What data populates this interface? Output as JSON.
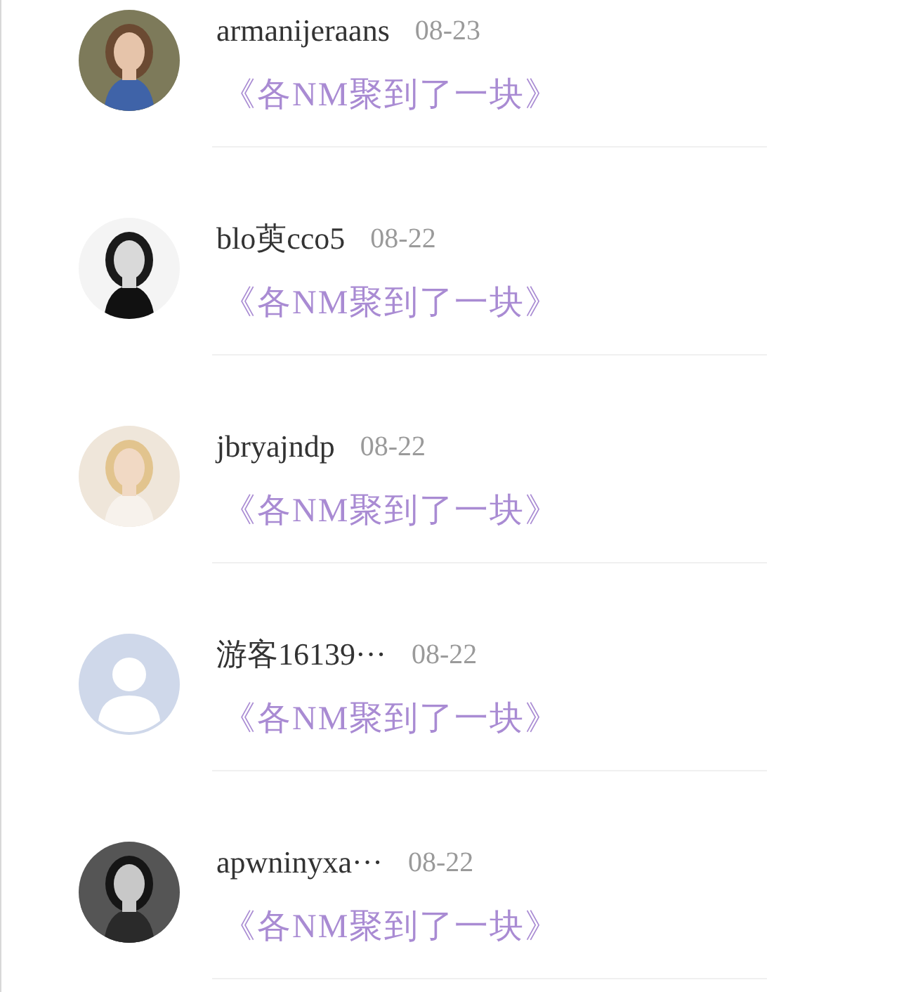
{
  "comments": [
    {
      "name": "armanijeraans",
      "date": "08-23",
      "link": "《各NM聚到了一块》"
    },
    {
      "name": "blo萸cco5",
      "date": "08-22",
      "link": "《各NM聚到了一块》"
    },
    {
      "name": "jbryajndp",
      "date": "08-22",
      "link": "《各NM聚到了一块》"
    },
    {
      "avatar": {
        "kind": "default"
      },
      "name": "游客16139···",
      "date": "08-22",
      "link": "《各NM聚到了一块》"
    },
    {
      "name": "apwninyxa···",
      "date": "08-22",
      "link": "《各NM聚到了一块》"
    }
  ]
}
